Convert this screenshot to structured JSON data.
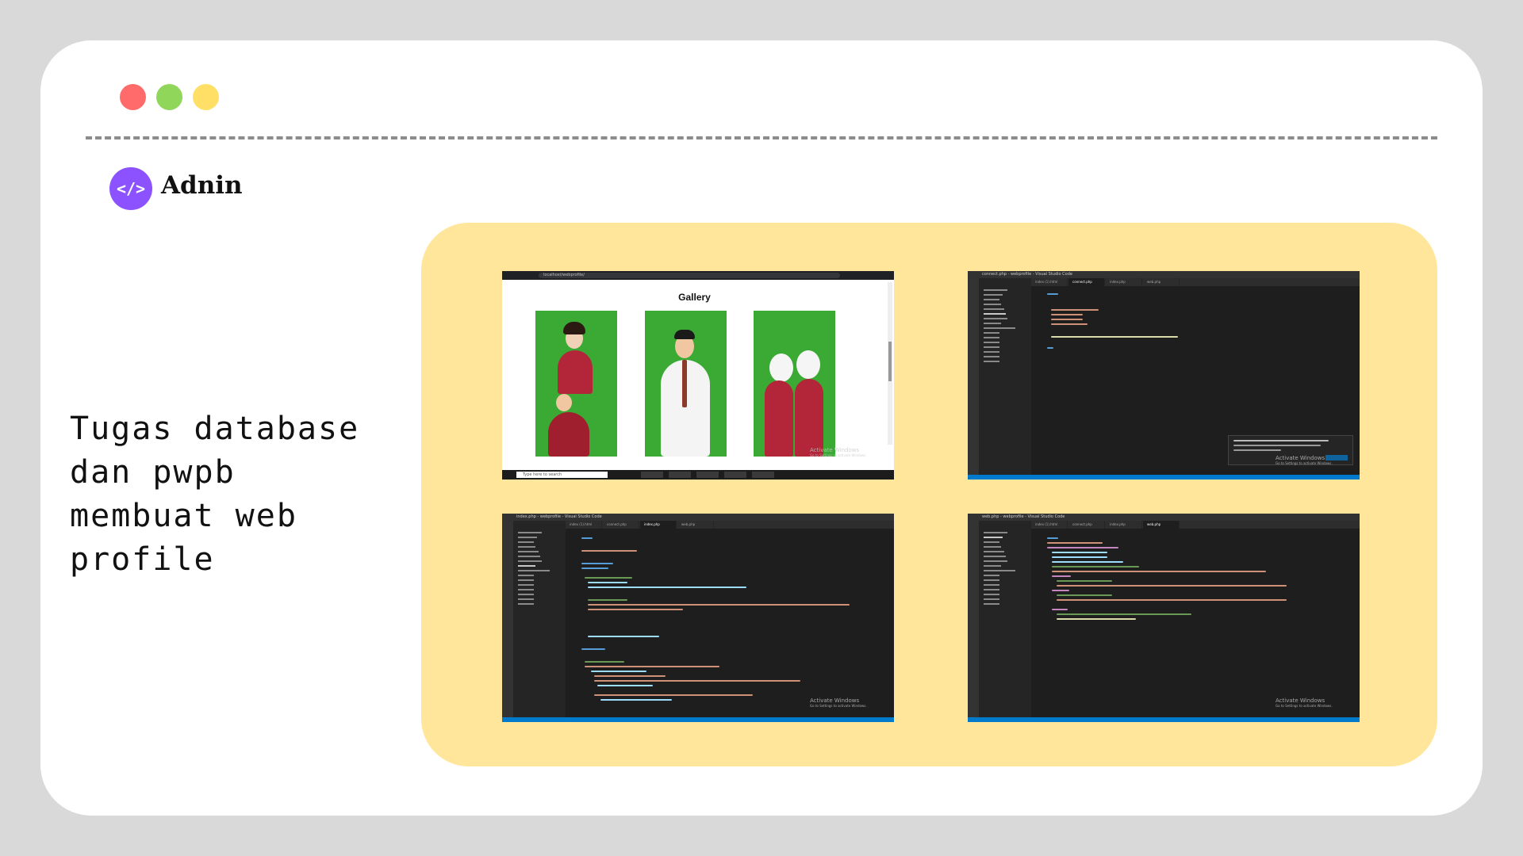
{
  "window": {
    "dots": [
      "red",
      "green",
      "yellow"
    ]
  },
  "brand": {
    "logo_glyph": "</>",
    "name": "Adnin"
  },
  "headline": {
    "lines": [
      "Tugas database",
      "dan pwpb",
      "membuat web",
      "profile"
    ]
  },
  "screens": {
    "gallery": {
      "title": "Gallery",
      "url": "localhost/webprofile/",
      "search_placeholder": "Type here to search",
      "watermark": {
        "title": "Activate Windows",
        "subtitle": "Go to Settings to activate Windows."
      }
    },
    "connect": {
      "window_title": "connect.php - webprofile - Visual Studio Code",
      "tabs": [
        "index (1).html",
        "connect.php",
        "index.php",
        "web.php"
      ],
      "watermark": {
        "title": "Activate Windows",
        "subtitle": "Go to Settings to activate Windows."
      }
    },
    "index": {
      "window_title": "index.php - webprofile - Visual Studio Code",
      "tabs": [
        "index (1).html",
        "connect.php",
        "index.php",
        "web.php"
      ],
      "watermark": {
        "title": "Activate Windows",
        "subtitle": "Go to Settings to activate Windows."
      }
    },
    "web": {
      "window_title": "web.php - webprofile - Visual Studio Code",
      "tabs": [
        "index (1).html",
        "connect.php",
        "index.php",
        "web.php"
      ],
      "watermark": {
        "title": "Activate Windows",
        "subtitle": "Go to Settings to activate Windows."
      }
    }
  },
  "colors": {
    "background": "#d9d9d9",
    "card": "#ffffff",
    "panel": "#ffe69a",
    "accent": "#8c52ff",
    "dot_red": "#ff6b6b",
    "dot_green": "#8fd65a",
    "dot_yellow": "#ffdf66"
  }
}
